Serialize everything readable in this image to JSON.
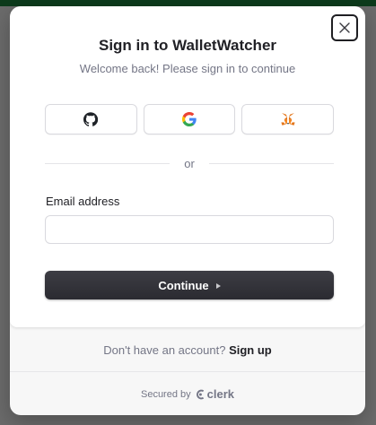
{
  "modal": {
    "title": "Sign in to WalletWatcher",
    "subtitle": "Welcome back! Please sign in to continue",
    "close_icon": "close-icon"
  },
  "social": [
    {
      "provider": "GitHub",
      "icon": "github-icon",
      "color": "#000000"
    },
    {
      "provider": "Google",
      "icon": "google-icon",
      "color": "#4285F4"
    },
    {
      "provider": "MetaMask",
      "icon": "metamask-icon",
      "color": "#E2761B"
    }
  ],
  "divider": {
    "label": "or"
  },
  "email": {
    "label": "Email address",
    "value": "",
    "placeholder": ""
  },
  "continue_button": {
    "label": "Continue"
  },
  "footer": {
    "prompt": "Don't have an account?",
    "signup_label": "Sign up",
    "secured_by": "Secured by",
    "brand": "clerk"
  },
  "colors": {
    "primary_button": "#2f2f35",
    "text": "#212126",
    "muted_text": "#747686",
    "backdrop": "#6b6b6b"
  }
}
